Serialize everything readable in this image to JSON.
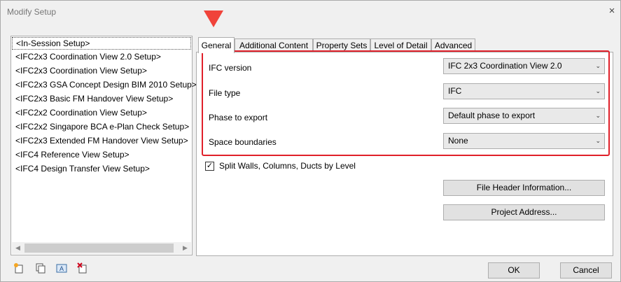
{
  "window": {
    "title": "Modify Setup",
    "close_glyph": "×"
  },
  "setups": [
    "<In-Session Setup>",
    "<IFC2x3 Coordination View 2.0 Setup>",
    "<IFC2x3 Coordination View Setup>",
    "<IFC2x3 GSA Concept Design BIM 2010 Setup>",
    "<IFC2x3 Basic FM Handover View Setup>",
    "<IFC2x2 Coordination View Setup>",
    "<IFC2x2 Singapore BCA e-Plan Check Setup>",
    "<IFC2x3 Extended FM Handover View Setup>",
    "<IFC4 Reference View Setup>",
    "<IFC4 Design Transfer View Setup>"
  ],
  "tabs": [
    "General",
    "Additional Content",
    "Property Sets",
    "Level of Detail",
    "Advanced"
  ],
  "fields": {
    "ifc_version": {
      "label": "IFC version",
      "value": "IFC 2x3 Coordination View 2.0"
    },
    "file_type": {
      "label": "File type",
      "value": "IFC"
    },
    "phase": {
      "label": "Phase to export",
      "value": "Default phase to export"
    },
    "space_boundaries": {
      "label": "Space boundaries",
      "value": "None"
    }
  },
  "split_walls": {
    "label": "Split Walls, Columns, Ducts by Level",
    "checked": true
  },
  "buttons": {
    "file_header": "File Header Information...",
    "project_address": "Project Address...",
    "ok": "OK",
    "cancel": "Cancel"
  },
  "toolbar_icons": [
    "new-setup-icon",
    "duplicate-setup-icon",
    "rename-setup-icon",
    "delete-setup-icon"
  ],
  "colors": {
    "highlight": "#e0202a",
    "arrow": "#f0433a"
  }
}
